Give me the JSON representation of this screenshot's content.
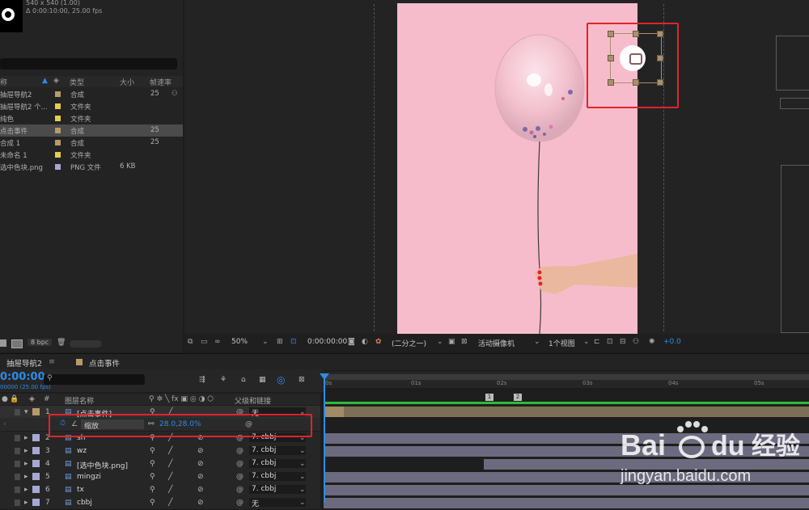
{
  "project": {
    "comp_info": [
      "540 x 540 (1.00)",
      "Δ 0:00:10:00, 25.00 fps"
    ],
    "columns": {
      "name": "称",
      "type": "类型",
      "size": "大小",
      "fps": "帧速率"
    },
    "items": [
      {
        "name": "抽屉导航2",
        "type": "合成",
        "size": "",
        "fps": "25",
        "color": "#b89a6a"
      },
      {
        "name": "抽屉导航2 个...",
        "type": "文件夹",
        "size": "",
        "fps": "",
        "color": "#e6cc4a"
      },
      {
        "name": "纯色",
        "type": "文件夹",
        "size": "",
        "fps": "",
        "color": "#e6cc4a"
      },
      {
        "name": "点击事件",
        "type": "合成",
        "size": "",
        "fps": "25",
        "color": "#b89a6a"
      },
      {
        "name": "合成 1",
        "type": "合成",
        "size": "",
        "fps": "25",
        "color": "#b89a6a"
      },
      {
        "name": "未命名 1",
        "type": "文件夹",
        "size": "",
        "fps": "",
        "color": "#e6cc4a"
      },
      {
        "name": "选中色块.png",
        "type": "PNG 文件",
        "size": "6 KB",
        "fps": "",
        "color": "#a7a7d6"
      }
    ],
    "bpc": "8 bpc"
  },
  "viewer": {
    "zoom": "50%",
    "timecode": "0:00:00:00",
    "resolution": "(二分之一)",
    "camera": "活动摄像机",
    "views": "1个视图",
    "exposure": "+0.0"
  },
  "timeline": {
    "tabs": [
      "抽屉导航2",
      "点击事件"
    ],
    "timecode": "0:00:00",
    "timecode_sub": "00000 (25.00 fps)",
    "columns": {
      "num": "#",
      "name": "图层名称",
      "parent": "父级和链接"
    },
    "property_label": "缩放",
    "property_value": "28.0,28.0%",
    "layers": [
      {
        "num": "1",
        "name": "[点击事件]",
        "parent": "无",
        "color": "#b89a6a"
      },
      {
        "num": "2",
        "name": "sh",
        "parent": "7. cbbj",
        "color": "#a7a7d6"
      },
      {
        "num": "3",
        "name": "wz",
        "parent": "7. cbbj",
        "color": "#a7a7d6"
      },
      {
        "num": "4",
        "name": "[选中色块.png]",
        "parent": "7. cbbj",
        "color": "#a7a7d6"
      },
      {
        "num": "5",
        "name": "mingzi",
        "parent": "7. cbbj",
        "color": "#a7a7d6"
      },
      {
        "num": "6",
        "name": "tx",
        "parent": "7. cbbj",
        "color": "#a7a7d6"
      },
      {
        "num": "7",
        "name": "cbbj",
        "parent": "无",
        "color": "#a7a7d6"
      }
    ],
    "ruler": [
      "0s",
      "01s",
      "02s",
      "03s",
      "04s",
      "05s"
    ],
    "markers": [
      "1",
      "2"
    ]
  },
  "watermark": {
    "brand": "Baidu",
    "cn": "经验",
    "url": "jingyan.baidu.com"
  }
}
